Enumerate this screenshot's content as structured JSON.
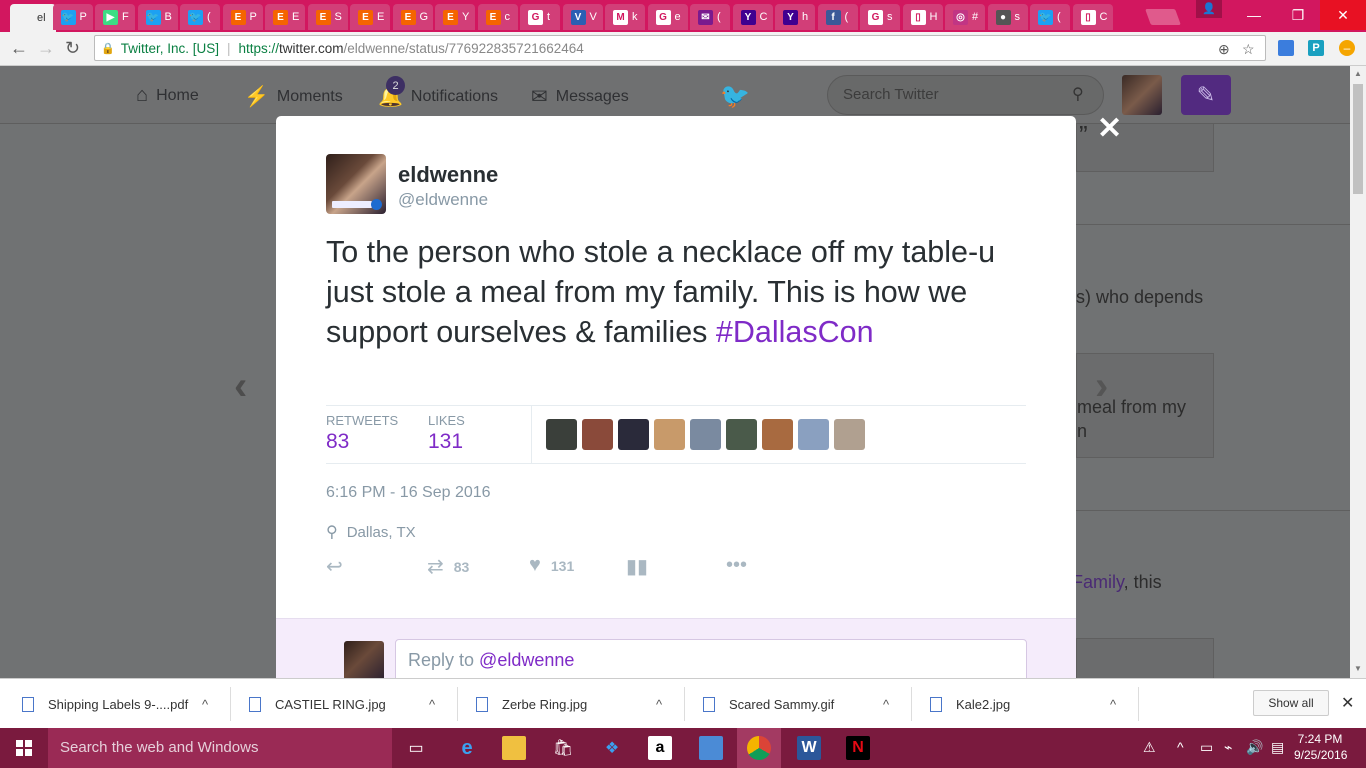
{
  "browser": {
    "tabs": [
      {
        "title": "el",
        "icon": "document-icon",
        "color": "#f2f2f2",
        "glyph": ""
      },
      {
        "title": "P",
        "icon": "twitter-icon",
        "color": "#1da1f2",
        "glyph": "🐦"
      },
      {
        "title": "F",
        "icon": "play-store-icon",
        "color": "#3ddc84",
        "glyph": "▶"
      },
      {
        "title": "B",
        "icon": "twitter-icon",
        "color": "#1da1f2",
        "glyph": "🐦"
      },
      {
        "title": "(",
        "icon": "twitter-icon",
        "color": "#1da1f2",
        "glyph": "🐦"
      },
      {
        "title": "P",
        "icon": "etsy-icon",
        "color": "#f56400",
        "glyph": "E"
      },
      {
        "title": "E",
        "icon": "etsy-icon",
        "color": "#f56400",
        "glyph": "E"
      },
      {
        "title": "S",
        "icon": "etsy-icon",
        "color": "#f56400",
        "glyph": "E"
      },
      {
        "title": "E",
        "icon": "etsy-icon",
        "color": "#f56400",
        "glyph": "E"
      },
      {
        "title": "G",
        "icon": "etsy-icon",
        "color": "#f56400",
        "glyph": "E"
      },
      {
        "title": "Y",
        "icon": "etsy-icon",
        "color": "#f56400",
        "glyph": "E"
      },
      {
        "title": "c",
        "icon": "etsy-icon",
        "color": "#f56400",
        "glyph": "E"
      },
      {
        "title": "t",
        "icon": "google-icon",
        "color": "#ffffff",
        "glyph": "G"
      },
      {
        "title": "V",
        "icon": "vee-icon",
        "color": "#2b5fb3",
        "glyph": "V"
      },
      {
        "title": "k",
        "icon": "gmail-icon",
        "color": "#ffffff",
        "glyph": "M"
      },
      {
        "title": "e",
        "icon": "google-icon",
        "color": "#ffffff",
        "glyph": "G"
      },
      {
        "title": "(",
        "icon": "mail-icon",
        "color": "#7a1a8e",
        "glyph": "✉"
      },
      {
        "title": "C",
        "icon": "yahoo-icon",
        "color": "#400090",
        "glyph": "Y"
      },
      {
        "title": "h",
        "icon": "yahoo-icon",
        "color": "#400090",
        "glyph": "Y"
      },
      {
        "title": "(",
        "icon": "facebook-icon",
        "color": "#3b5998",
        "glyph": "f"
      },
      {
        "title": "s",
        "icon": "google-icon",
        "color": "#ffffff",
        "glyph": "G"
      },
      {
        "title": "H",
        "icon": "document-icon",
        "color": "#ffffff",
        "glyph": "▯"
      },
      {
        "title": "#",
        "icon": "instagram-icon",
        "color": "#c13584",
        "glyph": "◎"
      },
      {
        "title": "s",
        "icon": "pin-icon",
        "color": "#555555",
        "glyph": "●"
      },
      {
        "title": "(",
        "icon": "twitter-icon",
        "color": "#1da1f2",
        "glyph": "🐦"
      },
      {
        "title": "C",
        "icon": "document-icon",
        "color": "#ffffff",
        "glyph": "▯"
      }
    ],
    "address": {
      "secure_label": "Twitter, Inc. [US]",
      "url_prefix": "https://",
      "url_host": "twitter.com",
      "url_path": "/eldwenne/status/776922835721662464"
    }
  },
  "twitter_nav": {
    "home": "Home",
    "moments": "Moments",
    "notifications": "Notifications",
    "notifications_count": "2",
    "messages": "Messages",
    "search_placeholder": "Search Twitter"
  },
  "background_cards": {
    "card1": "”",
    "card2": "s) who depends",
    "card3_line1": "meal from my",
    "card3_line2": "n",
    "card4_link": "Family",
    "card4_rest": ", this"
  },
  "tweet": {
    "name": "eldwenne",
    "handle": "@eldwenne",
    "text": "To the person who stole a necklace off my table-u just stole a meal from my family. This is how we support ourselves & families ",
    "hashtag": "#DallasCon",
    "retweets_label": "RETWEETS",
    "retweets": "83",
    "likes_label": "LIKES",
    "likes": "131",
    "likers": [
      {
        "color": "#3a3f3a"
      },
      {
        "color": "#8a4a3a"
      },
      {
        "color": "#2a2a3a"
      },
      {
        "color": "#c89a6a"
      },
      {
        "color": "#7a8aa0"
      },
      {
        "color": "#4a5a4a"
      },
      {
        "color": "#a86a40"
      },
      {
        "color": "#8aa0c0"
      },
      {
        "color": "#b0a090"
      }
    ],
    "timestamp": "6:16 PM - 16 Sep 2016",
    "location": "Dallas, TX",
    "retweet_count": "83",
    "like_count": "131",
    "reply_placeholder_prefix": "Reply to ",
    "reply_placeholder_handle": "@eldwenne"
  },
  "downloads": [
    {
      "name": "Shipping Labels 9-....pdf"
    },
    {
      "name": "CASTIEL RING.jpg"
    },
    {
      "name": "Zerbe Ring.jpg"
    },
    {
      "name": "Scared Sammy.gif"
    },
    {
      "name": "Kale2.jpg"
    }
  ],
  "downloads_show_all": "Show all",
  "taskbar": {
    "search_placeholder": "Search the web and Windows",
    "time": "7:24 PM",
    "date": "9/25/2016"
  },
  "colors": {
    "accent_purple": "#7f2bc7",
    "tabstrip": "#d2175f",
    "taskbar": "#7a1a3e"
  }
}
